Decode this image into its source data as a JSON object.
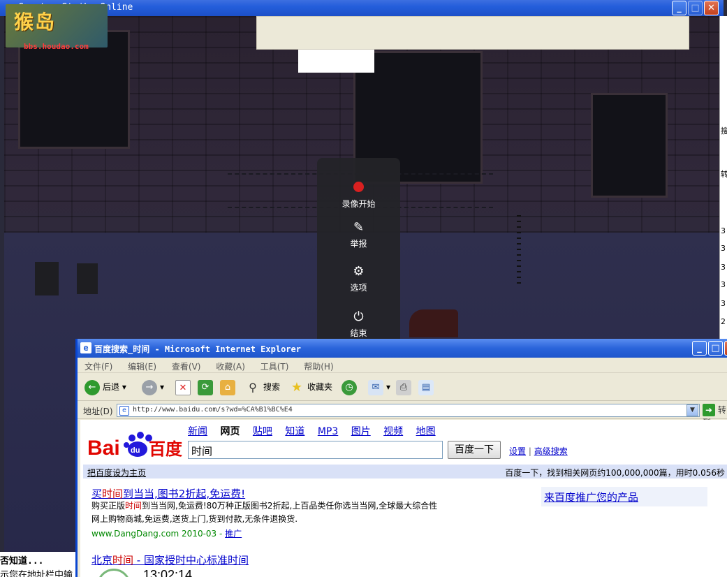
{
  "game": {
    "title": "Counter-Strike Online",
    "logo_text": "猴岛",
    "logo_url": "bbs.houdao.com"
  },
  "recorder": {
    "items": [
      {
        "label": "录像开始",
        "icon": "record-dot-icon"
      },
      {
        "label": "举报",
        "icon": "report-pen-icon"
      },
      {
        "label": "选项",
        "icon": "gear-icon"
      },
      {
        "label": "结束",
        "icon": "power-icon"
      }
    ]
  },
  "right_edge": {
    "chars": [
      "搜",
      "转",
      "3",
      "3",
      "3",
      "3",
      "3",
      "2"
    ]
  },
  "bottom_left": {
    "line1": "否知道...",
    "line2": "示您在地址栏中输"
  },
  "ie": {
    "title": "百度搜索_时间 - Microsoft Internet Explorer",
    "menu": [
      "文件(F)",
      "编辑(E)",
      "查看(V)",
      "收藏(A)",
      "工具(T)",
      "帮助(H)"
    ],
    "toolbar": {
      "back": "后退",
      "search": "搜索",
      "favorites": "收藏夹"
    },
    "address_label": "地址(D)",
    "address": "http://www.baidu.com/s?wd=%CA%B1%BC%E4",
    "go": "转到"
  },
  "baidu": {
    "nav": [
      "新闻",
      "网页",
      "贴吧",
      "知道",
      "MP3",
      "图片",
      "视频",
      "地图"
    ],
    "nav_current": "网页",
    "logo": "Bai百度",
    "query": "时间",
    "search_button": "百度一下",
    "settings": "设置",
    "advanced": "高级搜索",
    "set_home": "把百度设为主页",
    "stats": "百度一下，找到相关网页约100,000,000篇，用时0.056秒",
    "promo": "来百度推广您的产品",
    "results": [
      {
        "title_pre": "买",
        "title_hl": "时间",
        "title_post": "到当当,图书2折起,免运费!",
        "desc1_pre": "购买正版",
        "desc1_hl": "时间",
        "desc1_post": "到当当网,免运费!80万种正版图书2折起,上百品类任你选当当网,全球最大综合性",
        "desc2": "网上购物商城,免运费,送货上门,货到付款,无条件退换货.",
        "url": "www.DangDang.com 2010-03 - ",
        "promo_link": "推广"
      },
      {
        "title_pre": "北京",
        "title_hl": "时间",
        "title_post": " - 国家授时中心标准时间",
        "time": "13:02:14"
      }
    ]
  }
}
